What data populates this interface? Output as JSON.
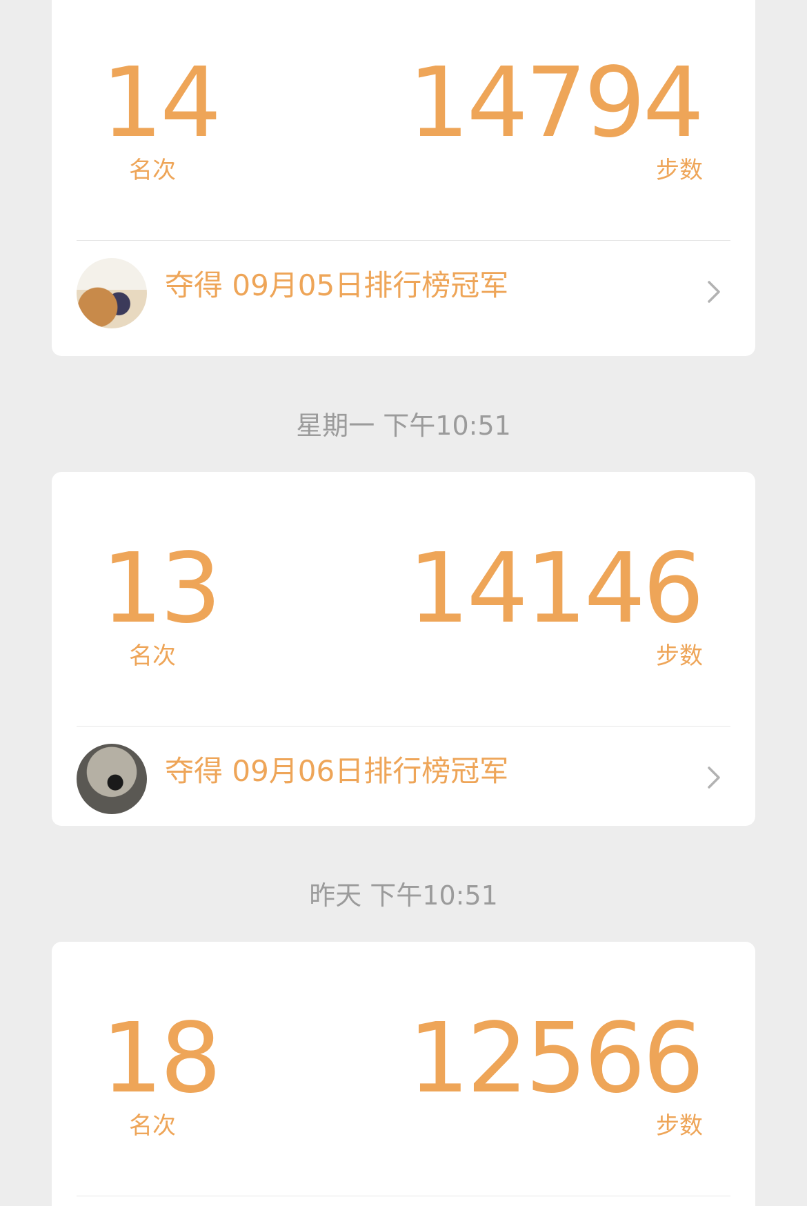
{
  "theme": {
    "accent": "#eea558",
    "background": "#ededed",
    "card": "#ffffff",
    "muted": "#9b9b9b"
  },
  "cards": [
    {
      "rank": "14",
      "rank_label": "名次",
      "steps": "14794",
      "steps_label": "步数",
      "champion_text": "夺得 09月05日排行榜冠军",
      "chevron_icon": "chevron-right-icon"
    },
    {
      "rank": "13",
      "rank_label": "名次",
      "steps": "14146",
      "steps_label": "步数",
      "champion_text": "夺得 09月06日排行榜冠军",
      "chevron_icon": "chevron-right-icon"
    },
    {
      "rank": "18",
      "rank_label": "名次",
      "steps": "12566",
      "steps_label": "步数"
    }
  ],
  "timestamps": [
    "星期一 下午10:51",
    "昨天 下午10:51"
  ]
}
